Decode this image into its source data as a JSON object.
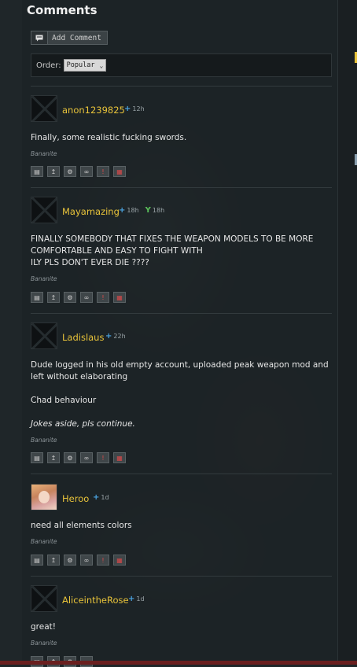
{
  "page_title": "Comments",
  "add_comment_label": "Add Comment",
  "order": {
    "label": "Order:",
    "selected": "Popular"
  },
  "comments": [
    {
      "username": "anon1239825",
      "time": "12h",
      "lines": [
        "Finally, some realistic fucking swords."
      ],
      "signature": "Bananite"
    },
    {
      "username": "Mayamazing",
      "time": "18h",
      "time2": "18h",
      "lines": [
        "FINALLY SOMEBODY THAT FIXES THE WEAPON MODELS TO BE MORE COMFORTABLE AND EASY TO FIGHT WITH",
        "ILY PLS DON'T EVER DIE ????"
      ],
      "signature": "Bananite"
    },
    {
      "username": "Ladislaus",
      "time": "22h",
      "lines": [
        "Dude logged in his old empty account, uploaded peak weapon mod and left without elaborating",
        "",
        "Chad behaviour",
        "",
        "Jokes aside, pls continue."
      ],
      "signature": "Bananite"
    },
    {
      "username": "Heroo",
      "time": "1d",
      "lines": [
        "need all elements colors"
      ],
      "signature": "Bananite"
    },
    {
      "username": "AliceintheRose",
      "time": "1d",
      "lines": [
        "great!"
      ],
      "signature": "Bananite"
    }
  ],
  "icons": {
    "add": "comment-add-icon",
    "actions": [
      "reply-icon",
      "upload-icon",
      "moderate-icon",
      "link-icon",
      "report-icon",
      "delete-icon"
    ],
    "points": "plus-icon",
    "fork": "fork-icon"
  },
  "colors": {
    "username": "#e8c33a",
    "plus": "#4aa3e0",
    "fork": "#5ac05a",
    "delete": "#d84a4a"
  }
}
